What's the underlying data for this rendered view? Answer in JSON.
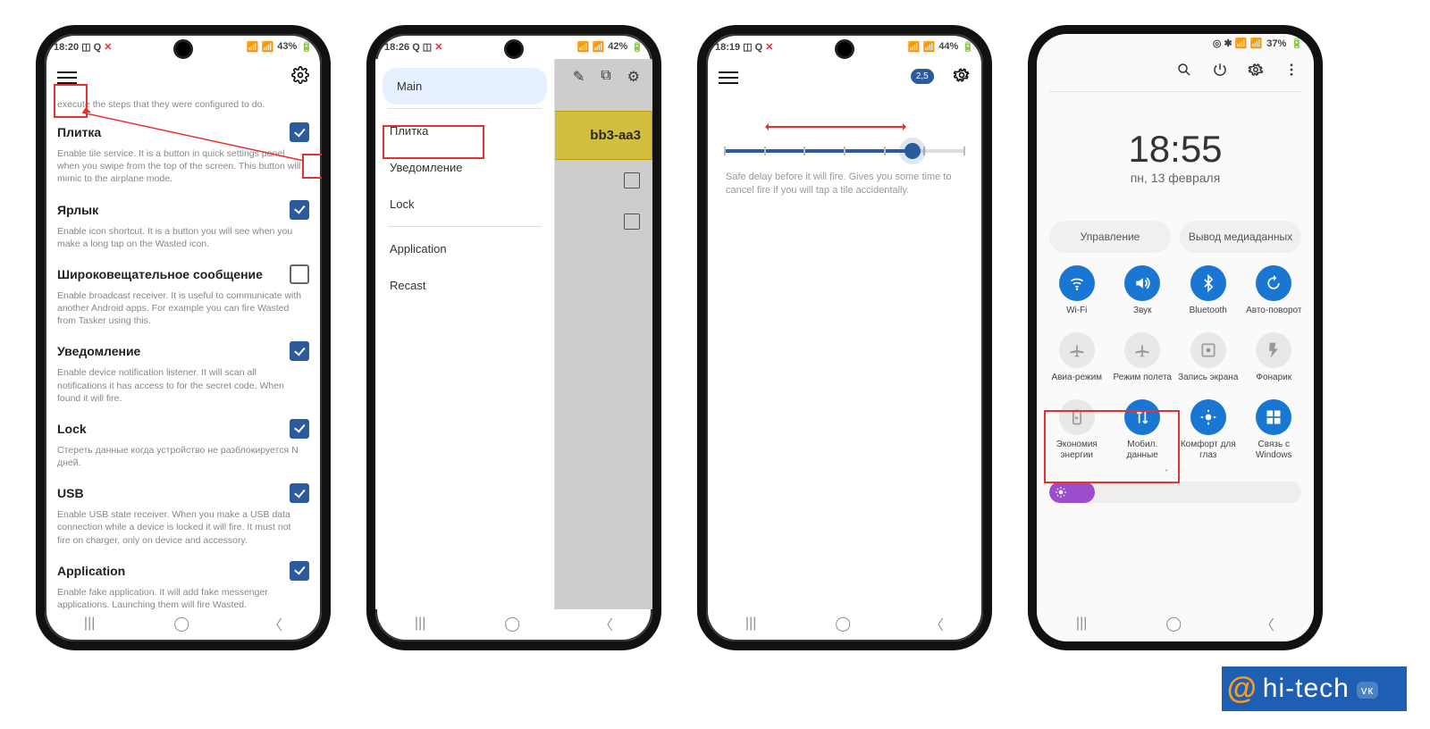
{
  "phone1": {
    "time": "18:20",
    "status_icons": "◫ Q ✕",
    "battery": "43%",
    "pre_text": "execute the steps that they were configured to do.",
    "items": [
      {
        "title": "Плитка",
        "desc": "Enable tile service. It is a button in quick settings panel when you swipe from the top of the screen. This button will mimic to the airplane mode.",
        "checked": true
      },
      {
        "title": "Ярлык",
        "desc": "Enable icon shortcut. It is a button you will see when you make a long tap on the Wasted icon.",
        "checked": true
      },
      {
        "title": "Широковещательное сообщение",
        "desc": "Enable broadcast receiver. It is useful to communicate with another Android apps. For example you can fire Wasted from Tasker using this.",
        "checked": false
      },
      {
        "title": "Уведомление",
        "desc": "Enable device notification listener. It will scan all notifications it has access to for the secret code. When found it will fire.",
        "checked": true
      },
      {
        "title": "Lock",
        "desc": "Стереть данные когда устройство не разблокируется N дней.",
        "checked": true
      },
      {
        "title": "USB",
        "desc": "Enable USB state receiver. When you make a USB data connection while a device is locked it will fire. It must not fire on charger, only on device and accessory.",
        "checked": true
      },
      {
        "title": "Application",
        "desc": "Enable fake application. It will add fake messenger applications. Launching them will fire Wasted.",
        "checked": true
      }
    ]
  },
  "phone2": {
    "time": "18:26",
    "battery": "42%",
    "drawer_items": [
      "Main",
      "Плитка",
      "Уведомление",
      "Lock",
      "Application",
      "Recast"
    ],
    "chip": "bb3-aa3"
  },
  "phone3": {
    "time": "18:19",
    "battery": "44%",
    "slider_value": "2,5",
    "desc": "Safe delay before it will fire. Gives you some time to cancel fire if you will tap a tile accidentally."
  },
  "phone4": {
    "battery": "37%",
    "clock": "18:55",
    "date": "пн, 13 февраля",
    "buttons": [
      "Управление",
      "Вывод медиаданных"
    ],
    "tiles": [
      {
        "label": "Wi-Fi",
        "on": true,
        "icon": "wifi"
      },
      {
        "label": "Звук",
        "on": true,
        "icon": "sound"
      },
      {
        "label": "Bluetooth",
        "on": true,
        "icon": "bt"
      },
      {
        "label": "Авто-поворот",
        "on": true,
        "icon": "rotate"
      },
      {
        "label": "Авиа-режим",
        "on": false,
        "icon": "plane"
      },
      {
        "label": "Режим полета",
        "on": false,
        "icon": "plane"
      },
      {
        "label": "Запись экрана",
        "on": false,
        "icon": "rec"
      },
      {
        "label": "Фонарик",
        "on": false,
        "icon": "flash"
      },
      {
        "label": "Экономия энергии",
        "on": false,
        "icon": "battery"
      },
      {
        "label": "Мобил. данные",
        "on": true,
        "icon": "data"
      },
      {
        "label": "Комфорт для глаз",
        "on": true,
        "icon": "eye"
      },
      {
        "label": "Связь с Windows",
        "on": true,
        "icon": "win"
      }
    ]
  },
  "watermark": "hi-tech",
  "watermark_badge": "vк"
}
